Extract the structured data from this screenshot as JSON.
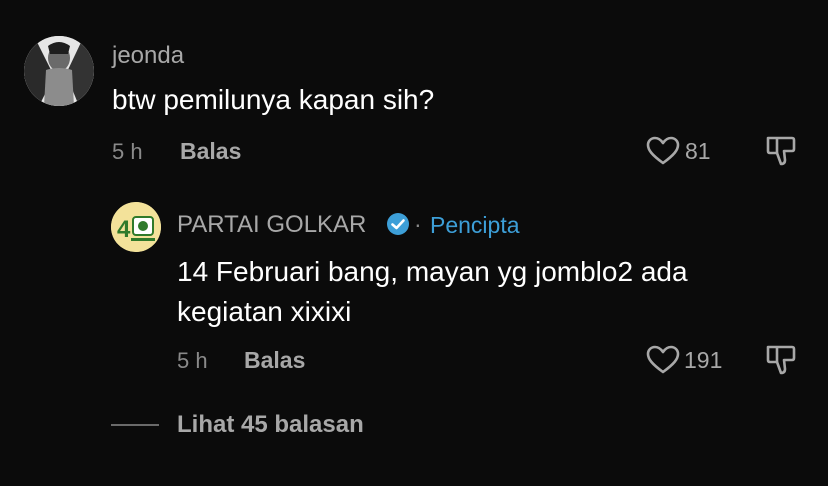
{
  "comment": {
    "username": "jeonda",
    "text": "btw pemilunya kapan sih?",
    "time": "5 h",
    "reply_label": "Balas",
    "likes": "81"
  },
  "reply": {
    "username": "PARTAI GOLKAR",
    "separator": "·",
    "creator_label": "Pencipta",
    "text_line1": "14 Februari bang, mayan yg jomblo2 ada",
    "text_line2": "kegiatan xixixi",
    "time": "5 h",
    "reply_label": "Balas",
    "likes": "191",
    "avatar_badge": "4"
  },
  "view_replies": {
    "label": "Lihat 45 balasan"
  },
  "colors": {
    "background": "#0b0b0b",
    "verified": "#3d9fd8",
    "creator": "#3d9fd8",
    "muted": "#a8a8a8"
  },
  "icons": [
    "heart-icon",
    "dislike-icon",
    "verified-icon"
  ]
}
